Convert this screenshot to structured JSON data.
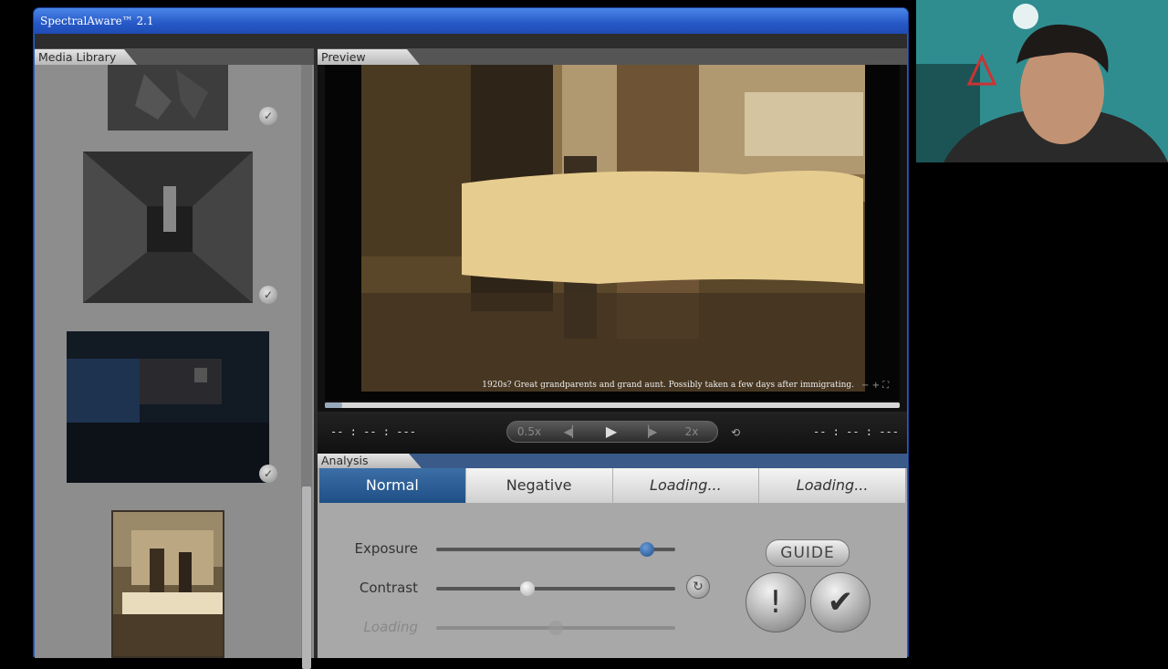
{
  "window": {
    "title": "SpectralAware™ 2.1"
  },
  "library": {
    "tab_label": "Media Library",
    "items": [
      {
        "kind": "photo",
        "selected": true
      },
      {
        "kind": "photo",
        "selected": true
      },
      {
        "kind": "photo",
        "selected": true
      },
      {
        "kind": "photo",
        "selected": false
      }
    ]
  },
  "preview": {
    "tab_label": "Preview",
    "caption": "1920s? Great grandparents and grand aunt. Possibly taken a few days after immigrating.",
    "time_left": "-- : -- : ---",
    "time_right": "-- : -- : ---",
    "slow_label": "0.5x",
    "fast_label": "2x",
    "seek_progress": 0.03
  },
  "analysis": {
    "tab_label": "Analysis",
    "modes": [
      {
        "label": "Normal",
        "active": true
      },
      {
        "label": "Negative",
        "active": false
      },
      {
        "label": "Loading...",
        "active": false
      },
      {
        "label": "Loading...",
        "active": false
      }
    ],
    "sliders": [
      {
        "label": "Exposure",
        "value": 0.88
      },
      {
        "label": "Contrast",
        "value": 0.38
      },
      {
        "label": "Loading",
        "value": 0.5
      }
    ],
    "guide_label": "GUIDE"
  },
  "icons": {
    "check": "checkmark-icon",
    "rewind": "step-back-icon",
    "play": "play-icon",
    "forward": "step-forward-icon",
    "loop": "loop-icon",
    "reset": "reset-icon",
    "alert": "exclamation-icon",
    "confirm": "checkmark-icon"
  },
  "colors": {
    "accent": "#2658c6",
    "active_mode": "#2b5c94"
  }
}
